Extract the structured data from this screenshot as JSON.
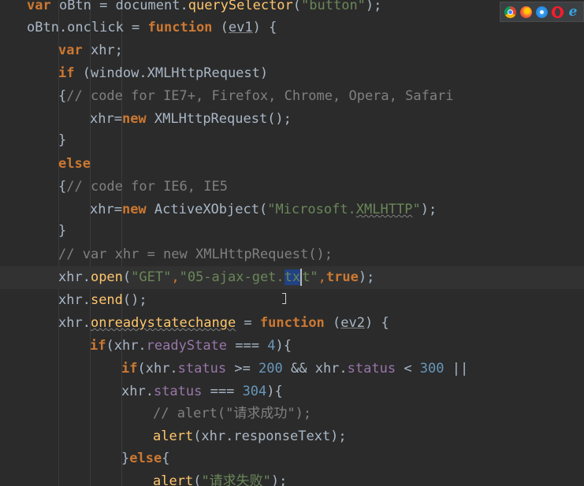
{
  "code": {
    "l1": {
      "var": "var",
      "name": " oBtn = document.",
      "method": "querySelector",
      "open": "(",
      "arg": "\"button\"",
      "close": ");"
    },
    "l2": {
      "name": "oBtn.onclick = ",
      "function": "function",
      "param": "ev1",
      "rest": ") {",
      "open": " ("
    },
    "l3": {
      "var": "var",
      "rest": " xhr;"
    },
    "l4": {
      "if": "if",
      "rest": " (window.XMLHttpRequest)"
    },
    "l5": {
      "brace": "{",
      "comment": "// code for IE7+, Firefox, Chrome, Opera, Safari"
    },
    "l6": {
      "lhs": "xhr=",
      "new": "new",
      "rest": " XMLHttpRequest();"
    },
    "l7": {
      "text": "}"
    },
    "l8": {
      "else": "else"
    },
    "l9": {
      "brace": "{",
      "comment": "// code for IE6, IE5"
    },
    "l10": {
      "lhs": "xhr=",
      "new": "new",
      "ctor": " ActiveXObject(",
      "str_a": "\"Microsoft.",
      "str_b": "XMLHTTP",
      "str_c": "\"",
      "rest": ");"
    },
    "l11": {
      "text": "}"
    },
    "l12": {
      "comment": "// var xhr = new XMLHttpRequest();"
    },
    "l13": {
      "obj": "xhr.",
      "method": "open",
      "open": "(",
      "arg1": "\"GET\"",
      "comma": ",",
      "arg2a": "\"05-ajax-get.",
      "arg2sel": "tx",
      "arg2b": "t\"",
      "comma2": ",",
      "bool": "true",
      "close": ");"
    },
    "l14": {
      "obj": "xhr.",
      "method": "send",
      "rest": "();"
    },
    "l15": {
      "obj": "xhr.",
      "prop": "onreadystatechange",
      "eq": " = ",
      "function": "function",
      "open": " (",
      "param": "ev2",
      "rest": ") {"
    },
    "l16": {
      "if": "if",
      "open": "(xhr.",
      "prop": "readyState",
      "op": " === ",
      "num": "4",
      "rest": "){"
    },
    "l17": {
      "if": "if",
      "open": "(xhr.",
      "prop": "status",
      "op1": " >= ",
      "num1": "200",
      "op2": " && xhr.",
      "prop2": "status",
      "op3": " < ",
      "num2": "300",
      "op4": " ||"
    },
    "l18": {
      "obj": "xhr.",
      "prop": "status",
      "op": " === ",
      "num": "304",
      "rest": "){"
    },
    "l19": {
      "comment": "// alert(\"请求成功\");"
    },
    "l20": {
      "fn": "alert",
      "rest": "(xhr.responseText);"
    },
    "l21": {
      "brace": "}",
      "else": "else",
      "rest": "{"
    },
    "l22": {
      "fn": "alert",
      "open": "(",
      "str": "\"请求失败\"",
      "rest": ");"
    }
  },
  "browser_bar": {
    "icons": [
      "chrome-icon",
      "firefox-icon",
      "safari-icon",
      "opera-icon",
      "ie-icon"
    ],
    "ie_glyph": "e"
  },
  "colors": {
    "background": "#2b2b2b",
    "keyword": "#cc7832",
    "string": "#6a8759",
    "number": "#6897bb",
    "property": "#9876aa",
    "function": "#ffc66d",
    "comment": "#808080",
    "text": "#a9b7c6",
    "selection": "#214283"
  }
}
